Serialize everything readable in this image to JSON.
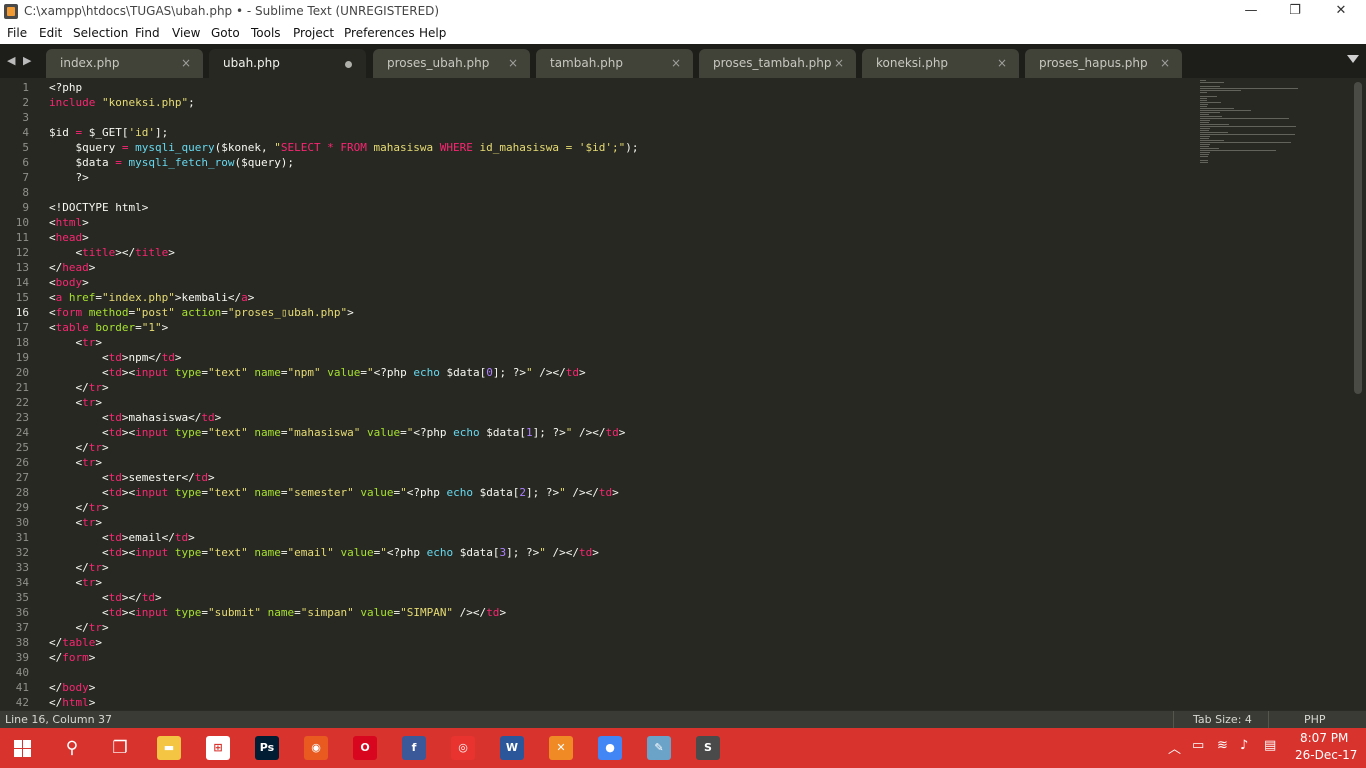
{
  "window": {
    "title": "C:\\xampp\\htdocs\\TUGAS\\ubah.php • - Sublime Text (UNREGISTERED)",
    "minimize": "—",
    "restore": "❐",
    "close": "✕"
  },
  "menu": [
    "File",
    "Edit",
    "Selection",
    "Find",
    "View",
    "Goto",
    "Tools",
    "Project",
    "Preferences",
    "Help"
  ],
  "tabs": [
    {
      "label": "index.php",
      "active": false,
      "dirty": false
    },
    {
      "label": "ubah.php",
      "active": true,
      "dirty": true
    },
    {
      "label": "proses_ubah.php",
      "active": false,
      "dirty": false
    },
    {
      "label": "tambah.php",
      "active": false,
      "dirty": false
    },
    {
      "label": "proses_tambah.php",
      "active": false,
      "dirty": false
    },
    {
      "label": "koneksi.php",
      "active": false,
      "dirty": false
    },
    {
      "label": "proses_hapus.php",
      "active": false,
      "dirty": false
    }
  ],
  "tab_close_glyph": "×",
  "nav": {
    "back": "◀",
    "forward": "▶"
  },
  "editor": {
    "current_line": 16,
    "lines": [
      [
        [
          "pln",
          "<?php"
        ]
      ],
      [
        [
          "kw",
          "include"
        ],
        [
          "pln",
          " "
        ],
        [
          "str",
          "\"koneksi.php\""
        ],
        [
          "pln",
          ";"
        ]
      ],
      [],
      [
        [
          "pln",
          "$id "
        ],
        [
          "kw",
          "="
        ],
        [
          "pln",
          " $_GET["
        ],
        [
          "str",
          "'id'"
        ],
        [
          "pln",
          "];"
        ]
      ],
      [
        [
          "pln",
          "    $query "
        ],
        [
          "kw",
          "="
        ],
        [
          "pln",
          " "
        ],
        [
          "fn",
          "mysqli_query"
        ],
        [
          "pln",
          "($konek, "
        ],
        [
          "str",
          "\""
        ],
        [
          "kw",
          "SELECT * FROM"
        ],
        [
          "str",
          " mahasiswa "
        ],
        [
          "kw",
          "WHERE"
        ],
        [
          "str",
          " id_mahasiswa = '$id';\""
        ],
        [
          "pln",
          ");"
        ]
      ],
      [
        [
          "pln",
          "    $data "
        ],
        [
          "kw",
          "="
        ],
        [
          "pln",
          " "
        ],
        [
          "fn",
          "mysqli_fetch_row"
        ],
        [
          "pln",
          "($query);"
        ]
      ],
      [
        [
          "pln",
          "    ?>"
        ]
      ],
      [],
      [
        [
          "pln",
          "<!DOCTYPE html>"
        ]
      ],
      [
        [
          "pln",
          "<"
        ],
        [
          "tag",
          "html"
        ],
        [
          "pln",
          ">"
        ]
      ],
      [
        [
          "pln",
          "<"
        ],
        [
          "tag",
          "head"
        ],
        [
          "pln",
          ">"
        ]
      ],
      [
        [
          "pln",
          "    <"
        ],
        [
          "tag",
          "title"
        ],
        [
          "pln",
          "></"
        ],
        [
          "tag",
          "title"
        ],
        [
          "pln",
          ">"
        ]
      ],
      [
        [
          "pln",
          "</"
        ],
        [
          "tag",
          "head"
        ],
        [
          "pln",
          ">"
        ]
      ],
      [
        [
          "pln",
          "<"
        ],
        [
          "tag",
          "body"
        ],
        [
          "pln",
          ">"
        ]
      ],
      [
        [
          "pln",
          "<"
        ],
        [
          "tag",
          "a"
        ],
        [
          "pln",
          " "
        ],
        [
          "attr",
          "href"
        ],
        [
          "pln",
          "="
        ],
        [
          "str",
          "\"index.php\""
        ],
        [
          "pln",
          ">kembali</"
        ],
        [
          "tag",
          "a"
        ],
        [
          "pln",
          ">"
        ]
      ],
      [
        [
          "pln",
          "<"
        ],
        [
          "tag",
          "form"
        ],
        [
          "pln",
          " "
        ],
        [
          "attr",
          "method"
        ],
        [
          "pln",
          "="
        ],
        [
          "str",
          "\"post\""
        ],
        [
          "pln",
          " "
        ],
        [
          "attr",
          "action"
        ],
        [
          "pln",
          "="
        ],
        [
          "str",
          "\"proses_▯ubah.php\""
        ],
        [
          "pln",
          ">"
        ]
      ],
      [
        [
          "pln",
          "<"
        ],
        [
          "tag",
          "table"
        ],
        [
          "pln",
          " "
        ],
        [
          "attr",
          "border"
        ],
        [
          "pln",
          "="
        ],
        [
          "str",
          "\"1\""
        ],
        [
          "pln",
          ">"
        ]
      ],
      [
        [
          "pln",
          "    <"
        ],
        [
          "tag",
          "tr"
        ],
        [
          "pln",
          ">"
        ]
      ],
      [
        [
          "pln",
          "        <"
        ],
        [
          "tag",
          "td"
        ],
        [
          "pln",
          ">npm</"
        ],
        [
          "tag",
          "td"
        ],
        [
          "pln",
          ">"
        ]
      ],
      [
        [
          "pln",
          "        <"
        ],
        [
          "tag",
          "td"
        ],
        [
          "pln",
          "><"
        ],
        [
          "tag",
          "input"
        ],
        [
          "pln",
          " "
        ],
        [
          "attr",
          "type"
        ],
        [
          "pln",
          "="
        ],
        [
          "str",
          "\"text\""
        ],
        [
          "pln",
          " "
        ],
        [
          "attr",
          "name"
        ],
        [
          "pln",
          "="
        ],
        [
          "str",
          "\"npm\""
        ],
        [
          "pln",
          " "
        ],
        [
          "attr",
          "value"
        ],
        [
          "pln",
          "="
        ],
        [
          "str",
          "\""
        ],
        [
          "pln",
          "<?php "
        ],
        [
          "fn",
          "echo"
        ],
        [
          "pln",
          " $data["
        ],
        [
          "num",
          "0"
        ],
        [
          "pln",
          "]; ?>"
        ],
        [
          "str",
          "\""
        ],
        [
          "pln",
          " /></"
        ],
        [
          "tag",
          "td"
        ],
        [
          "pln",
          ">"
        ]
      ],
      [
        [
          "pln",
          "    </"
        ],
        [
          "tag",
          "tr"
        ],
        [
          "pln",
          ">"
        ]
      ],
      [
        [
          "pln",
          "    <"
        ],
        [
          "tag",
          "tr"
        ],
        [
          "pln",
          ">"
        ]
      ],
      [
        [
          "pln",
          "        <"
        ],
        [
          "tag",
          "td"
        ],
        [
          "pln",
          ">mahasiswa</"
        ],
        [
          "tag",
          "td"
        ],
        [
          "pln",
          ">"
        ]
      ],
      [
        [
          "pln",
          "        <"
        ],
        [
          "tag",
          "td"
        ],
        [
          "pln",
          "><"
        ],
        [
          "tag",
          "input"
        ],
        [
          "pln",
          " "
        ],
        [
          "attr",
          "type"
        ],
        [
          "pln",
          "="
        ],
        [
          "str",
          "\"text\""
        ],
        [
          "pln",
          " "
        ],
        [
          "attr",
          "name"
        ],
        [
          "pln",
          "="
        ],
        [
          "str",
          "\"mahasiswa\""
        ],
        [
          "pln",
          " "
        ],
        [
          "attr",
          "value"
        ],
        [
          "pln",
          "="
        ],
        [
          "str",
          "\""
        ],
        [
          "pln",
          "<?php "
        ],
        [
          "fn",
          "echo"
        ],
        [
          "pln",
          " $data["
        ],
        [
          "num",
          "1"
        ],
        [
          "pln",
          "]; ?>"
        ],
        [
          "str",
          "\""
        ],
        [
          "pln",
          " /></"
        ],
        [
          "tag",
          "td"
        ],
        [
          "pln",
          ">"
        ]
      ],
      [
        [
          "pln",
          "    </"
        ],
        [
          "tag",
          "tr"
        ],
        [
          "pln",
          ">"
        ]
      ],
      [
        [
          "pln",
          "    <"
        ],
        [
          "tag",
          "tr"
        ],
        [
          "pln",
          ">"
        ]
      ],
      [
        [
          "pln",
          "        <"
        ],
        [
          "tag",
          "td"
        ],
        [
          "pln",
          ">semester</"
        ],
        [
          "tag",
          "td"
        ],
        [
          "pln",
          ">"
        ]
      ],
      [
        [
          "pln",
          "        <"
        ],
        [
          "tag",
          "td"
        ],
        [
          "pln",
          "><"
        ],
        [
          "tag",
          "input"
        ],
        [
          "pln",
          " "
        ],
        [
          "attr",
          "type"
        ],
        [
          "pln",
          "="
        ],
        [
          "str",
          "\"text\""
        ],
        [
          "pln",
          " "
        ],
        [
          "attr",
          "name"
        ],
        [
          "pln",
          "="
        ],
        [
          "str",
          "\"semester\""
        ],
        [
          "pln",
          " "
        ],
        [
          "attr",
          "value"
        ],
        [
          "pln",
          "="
        ],
        [
          "str",
          "\""
        ],
        [
          "pln",
          "<?php "
        ],
        [
          "fn",
          "echo"
        ],
        [
          "pln",
          " $data["
        ],
        [
          "num",
          "2"
        ],
        [
          "pln",
          "]; ?>"
        ],
        [
          "str",
          "\""
        ],
        [
          "pln",
          " /></"
        ],
        [
          "tag",
          "td"
        ],
        [
          "pln",
          ">"
        ]
      ],
      [
        [
          "pln",
          "    </"
        ],
        [
          "tag",
          "tr"
        ],
        [
          "pln",
          ">"
        ]
      ],
      [
        [
          "pln",
          "    <"
        ],
        [
          "tag",
          "tr"
        ],
        [
          "pln",
          ">"
        ]
      ],
      [
        [
          "pln",
          "        <"
        ],
        [
          "tag",
          "td"
        ],
        [
          "pln",
          ">email</"
        ],
        [
          "tag",
          "td"
        ],
        [
          "pln",
          ">"
        ]
      ],
      [
        [
          "pln",
          "        <"
        ],
        [
          "tag",
          "td"
        ],
        [
          "pln",
          "><"
        ],
        [
          "tag",
          "input"
        ],
        [
          "pln",
          " "
        ],
        [
          "attr",
          "type"
        ],
        [
          "pln",
          "="
        ],
        [
          "str",
          "\"text\""
        ],
        [
          "pln",
          " "
        ],
        [
          "attr",
          "name"
        ],
        [
          "pln",
          "="
        ],
        [
          "str",
          "\"email\""
        ],
        [
          "pln",
          " "
        ],
        [
          "attr",
          "value"
        ],
        [
          "pln",
          "="
        ],
        [
          "str",
          "\""
        ],
        [
          "pln",
          "<?php "
        ],
        [
          "fn",
          "echo"
        ],
        [
          "pln",
          " $data["
        ],
        [
          "num",
          "3"
        ],
        [
          "pln",
          "]; ?>"
        ],
        [
          "str",
          "\""
        ],
        [
          "pln",
          " /></"
        ],
        [
          "tag",
          "td"
        ],
        [
          "pln",
          ">"
        ]
      ],
      [
        [
          "pln",
          "    </"
        ],
        [
          "tag",
          "tr"
        ],
        [
          "pln",
          ">"
        ]
      ],
      [
        [
          "pln",
          "    <"
        ],
        [
          "tag",
          "tr"
        ],
        [
          "pln",
          ">"
        ]
      ],
      [
        [
          "pln",
          "        <"
        ],
        [
          "tag",
          "td"
        ],
        [
          "pln",
          "></"
        ],
        [
          "tag",
          "td"
        ],
        [
          "pln",
          ">"
        ]
      ],
      [
        [
          "pln",
          "        <"
        ],
        [
          "tag",
          "td"
        ],
        [
          "pln",
          "><"
        ],
        [
          "tag",
          "input"
        ],
        [
          "pln",
          " "
        ],
        [
          "attr",
          "type"
        ],
        [
          "pln",
          "="
        ],
        [
          "str",
          "\"submit\""
        ],
        [
          "pln",
          " "
        ],
        [
          "attr",
          "name"
        ],
        [
          "pln",
          "="
        ],
        [
          "str",
          "\"simpan\""
        ],
        [
          "pln",
          " "
        ],
        [
          "attr",
          "value"
        ],
        [
          "pln",
          "="
        ],
        [
          "str",
          "\"SIMPAN\""
        ],
        [
          "pln",
          " /></"
        ],
        [
          "tag",
          "td"
        ],
        [
          "pln",
          ">"
        ]
      ],
      [
        [
          "pln",
          "    </"
        ],
        [
          "tag",
          "tr"
        ],
        [
          "pln",
          ">"
        ]
      ],
      [
        [
          "pln",
          "</"
        ],
        [
          "tag",
          "table"
        ],
        [
          "pln",
          ">"
        ]
      ],
      [
        [
          "pln",
          "</"
        ],
        [
          "tag",
          "form"
        ],
        [
          "pln",
          ">"
        ]
      ],
      [],
      [
        [
          "pln",
          "</"
        ],
        [
          "tag",
          "body"
        ],
        [
          "pln",
          ">"
        ]
      ],
      [
        [
          "pln",
          "</"
        ],
        [
          "tag",
          "html"
        ],
        [
          "pln",
          ">"
        ]
      ]
    ]
  },
  "statusbar": {
    "position": "Line 16, Column 37",
    "tab_size": "Tab Size: 4",
    "syntax": "PHP"
  },
  "taskbar": {
    "apps": [
      {
        "name": "search-icon",
        "glyph": "⚲",
        "color": ""
      },
      {
        "name": "task-view-icon",
        "glyph": "❐",
        "color": ""
      },
      {
        "name": "file-explorer-icon",
        "glyph": "▬",
        "color": "#f4c542"
      },
      {
        "name": "store-icon",
        "glyph": "⊞",
        "color": "#ffffff"
      },
      {
        "name": "photoshop-icon",
        "glyph": "Ps",
        "color": "#001d34"
      },
      {
        "name": "browser-icon",
        "glyph": "◉",
        "color": "#e85a20"
      },
      {
        "name": "opera-icon",
        "glyph": "O",
        "color": "#d8061e"
      },
      {
        "name": "facebook-icon",
        "glyph": "f",
        "color": "#3b5998"
      },
      {
        "name": "camera-app-icon",
        "glyph": "◎",
        "color": "#e8332f"
      },
      {
        "name": "word-icon",
        "glyph": "W",
        "color": "#2b579a"
      },
      {
        "name": "xampp-icon",
        "glyph": "✕",
        "color": "#f08a24"
      },
      {
        "name": "chrome-icon",
        "glyph": "●",
        "color": "#4285f4"
      },
      {
        "name": "paint-icon",
        "glyph": "✎",
        "color": "#6aa2c8"
      },
      {
        "name": "sublime-text-icon",
        "glyph": "S",
        "color": "#4a4a4a"
      }
    ],
    "tray": {
      "chevron": "︿",
      "battery": "▭",
      "wifi": "≋",
      "volume": "♪",
      "notifications": "▤"
    },
    "time": "8:07 PM",
    "date": "26-Dec-17"
  }
}
